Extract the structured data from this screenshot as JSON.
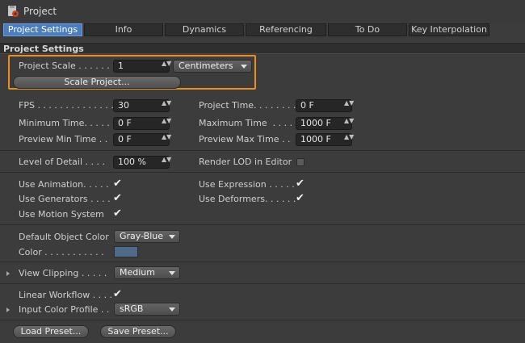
{
  "window": {
    "title": "Project",
    "icon": "project-gear-icon"
  },
  "tabs": [
    {
      "label": "Project Settings",
      "active": true
    },
    {
      "label": "Info"
    },
    {
      "label": "Dynamics"
    },
    {
      "label": "Referencing"
    },
    {
      "label": "To Do"
    },
    {
      "label": "Key Interpolation"
    }
  ],
  "section": {
    "title": "Project Settings"
  },
  "project_scale": {
    "label": "Project Scale . . . . . .",
    "value": "1",
    "unit": "Centimeters",
    "scale_button": "Scale Project..."
  },
  "time": {
    "fps_label": "FPS . . . . . . . . . . . . . .",
    "fps_value": "30",
    "project_time_label": "Project Time. . . . . . . .",
    "project_time_value": "0 F",
    "min_time_label": "Minimum Time. . . . .",
    "min_time_value": "0 F",
    "max_time_label": "Maximum Time  . . . .",
    "max_time_value": "1000 F",
    "preview_min_label": "Preview Min Time . .",
    "preview_min_value": "0 F",
    "preview_max_label": "Preview Max Time . .",
    "preview_max_value": "1000 F"
  },
  "lod": {
    "label": "Level of Detail . . . .",
    "value": "100 %",
    "render_lod_label": "Render LOD in Editor"
  },
  "checks": {
    "use_animation": "Use Animation. . . . .",
    "use_expression": "Use Expression . . . . .",
    "use_generators": "Use Generators . . . .",
    "use_deformers": "Use Deformers. . . . . .",
    "use_motion": "Use Motion System",
    "check_glyph": "✔"
  },
  "object_color": {
    "label": "Default Object Color",
    "value": "Gray-Blue",
    "color_label": "Color . . . . . . . . . . .",
    "swatch_color": "#506a8a"
  },
  "clipping": {
    "label": "View Clipping . . . . .",
    "value": "Medium"
  },
  "linear_workflow": {
    "label": "Linear Workflow . . . ."
  },
  "input_profile": {
    "label": "Input Color Profile . .",
    "value": "sRGB"
  },
  "presets": {
    "load": "Load Preset...",
    "save": "Save Preset..."
  },
  "spin_glyph": "▲▼",
  "colors": {
    "accent": "#4a7ec1",
    "highlight": "#e98f1f",
    "background": "#3c3c3c"
  }
}
